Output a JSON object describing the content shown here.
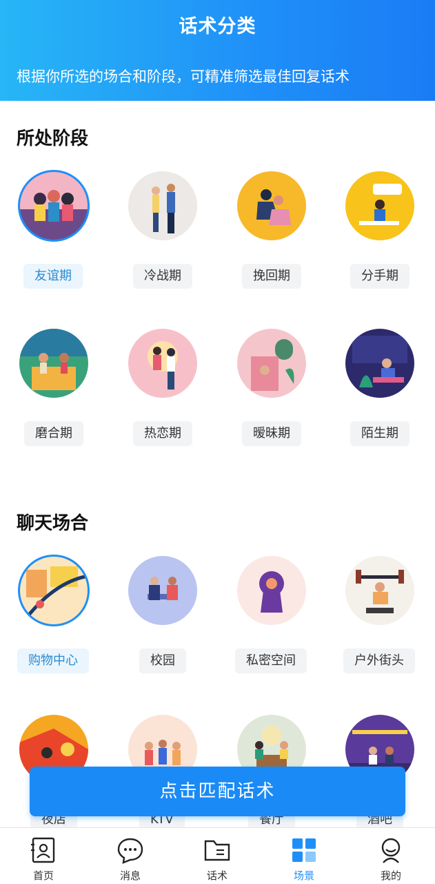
{
  "header": {
    "title": "话术分类",
    "subtitle": "根据你所选的场合和阶段，可精准筛选最佳回复话术"
  },
  "stages": {
    "title": "所处阶段",
    "items": [
      {
        "label": "友谊期",
        "selected": true
      },
      {
        "label": "冷战期",
        "selected": false
      },
      {
        "label": "挽回期",
        "selected": false
      },
      {
        "label": "分手期",
        "selected": false
      },
      {
        "label": "磨合期",
        "selected": false
      },
      {
        "label": "热恋期",
        "selected": false
      },
      {
        "label": "暧昧期",
        "selected": false
      },
      {
        "label": "陌生期",
        "selected": false
      }
    ]
  },
  "scenes": {
    "title": "聊天场合",
    "items": [
      {
        "label": "购物中心",
        "selected": true
      },
      {
        "label": "校园",
        "selected": false
      },
      {
        "label": "私密空间",
        "selected": false
      },
      {
        "label": "户外街头",
        "selected": false
      },
      {
        "label": "夜店",
        "selected": false
      },
      {
        "label": "KTV",
        "selected": false
      },
      {
        "label": "餐厅",
        "selected": false
      },
      {
        "label": "酒吧",
        "selected": false
      }
    ]
  },
  "match_button": "点击匹配话术",
  "tabbar": {
    "items": [
      {
        "label": "首页",
        "icon": "contact-card-icon"
      },
      {
        "label": "消息",
        "icon": "chat-bubble-icon"
      },
      {
        "label": "话术",
        "icon": "folder-icon"
      },
      {
        "label": "场景",
        "icon": "grid-icon",
        "active": true
      },
      {
        "label": "我的",
        "icon": "user-icon"
      }
    ]
  },
  "colors": {
    "primary": "#1f8ff8",
    "header_gradient_start": "#27b6f6",
    "selected_text": "#2a8bd0",
    "selected_bg": "#eaf5fd"
  }
}
